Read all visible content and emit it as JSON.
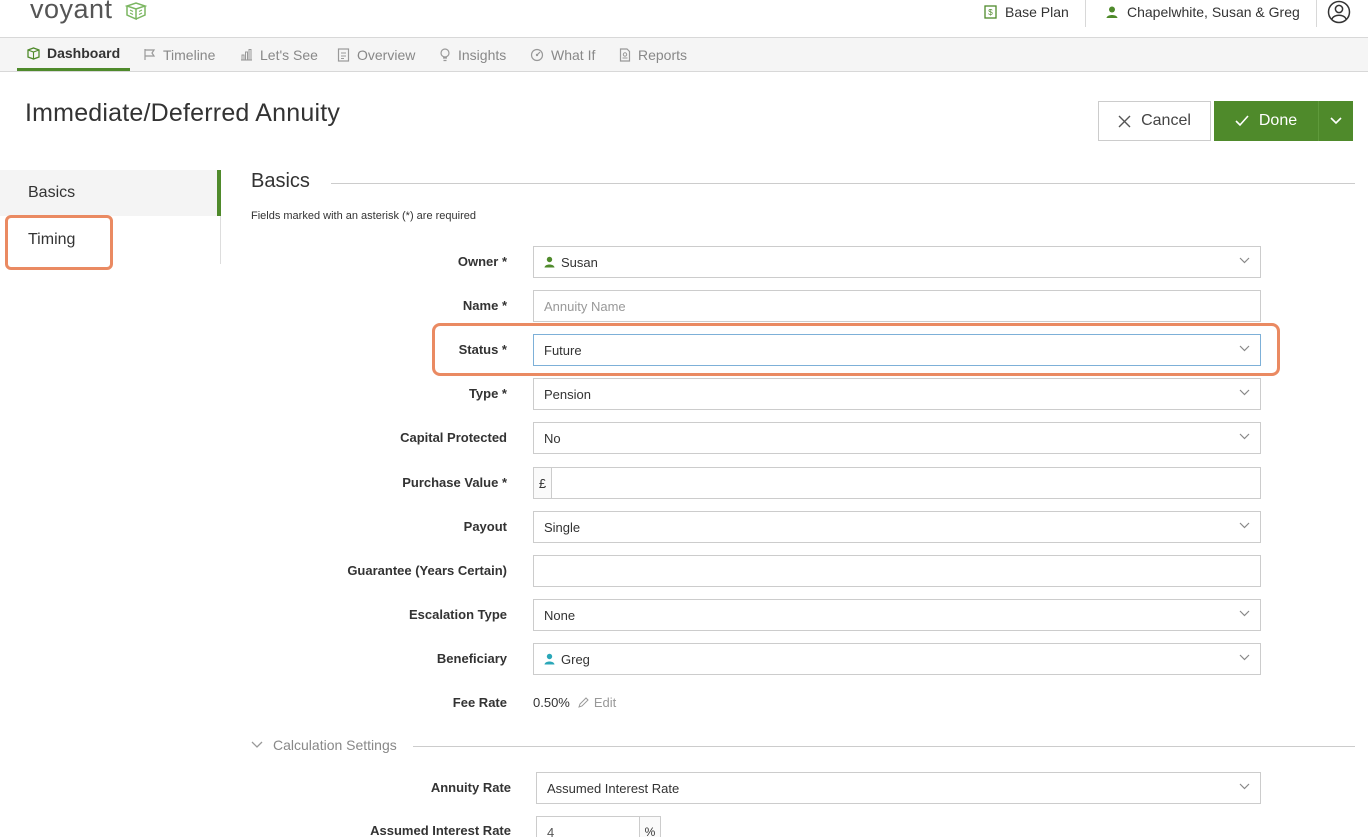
{
  "header": {
    "logo": "voyant",
    "plan": "Base Plan",
    "client": "Chapelwhite, Susan & Greg"
  },
  "nav": {
    "tabs": [
      {
        "label": "Dashboard",
        "icon": "dashboard-icon"
      },
      {
        "label": "Timeline",
        "icon": "flag-icon"
      },
      {
        "label": "Let's See",
        "icon": "bar-chart-icon"
      },
      {
        "label": "Overview",
        "icon": "document-icon"
      },
      {
        "label": "Insights",
        "icon": "lightbulb-icon"
      },
      {
        "label": "What If",
        "icon": "what-if-icon"
      },
      {
        "label": "Reports",
        "icon": "report-icon"
      }
    ]
  },
  "page": {
    "title": "Immediate/Deferred Annuity",
    "cancel_label": "Cancel",
    "done_label": "Done"
  },
  "sidenav": {
    "items": [
      "Basics",
      "Timing"
    ]
  },
  "form": {
    "section_title": "Basics",
    "required_note": "Fields marked with an asterisk (*) are required",
    "owner": {
      "label": "Owner *",
      "value": "Susan"
    },
    "name": {
      "label": "Name *",
      "placeholder": "Annuity Name"
    },
    "status": {
      "label": "Status *",
      "value": "Future"
    },
    "type": {
      "label": "Type *",
      "value": "Pension"
    },
    "capital_protected": {
      "label": "Capital Protected",
      "value": "No"
    },
    "purchase_value": {
      "label": "Purchase Value *",
      "prefix": "£",
      "value": ""
    },
    "payout": {
      "label": "Payout",
      "value": "Single"
    },
    "guarantee": {
      "label": "Guarantee (Years Certain)",
      "value": ""
    },
    "escalation_type": {
      "label": "Escalation Type",
      "value": "None"
    },
    "beneficiary": {
      "label": "Beneficiary",
      "value": "Greg"
    },
    "fee_rate": {
      "label": "Fee Rate",
      "value": "0.50%",
      "edit_label": "Edit"
    }
  },
  "calc": {
    "title": "Calculation Settings",
    "annuity_rate": {
      "label": "Annuity Rate",
      "value": "Assumed Interest Rate"
    },
    "assumed_interest_rate": {
      "label": "Assumed Interest Rate",
      "value": "4",
      "suffix": "%"
    }
  },
  "colors": {
    "brand_green": "#4f8a2b",
    "highlight": "#ea8a62",
    "susan_icon": "#4f8a2b",
    "greg_icon": "#2aa7b8"
  }
}
